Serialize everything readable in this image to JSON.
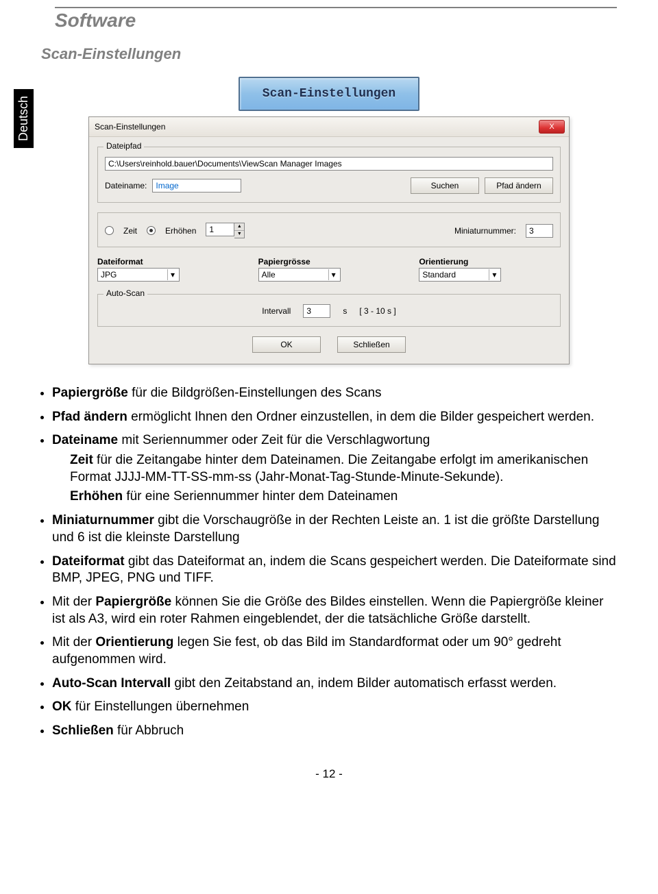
{
  "header": {
    "title": "Software",
    "subtitle": "Scan-Einstellungen"
  },
  "lang_tab": "Deutsch",
  "toolbar_button": {
    "label": "Scan-Einstellungen"
  },
  "dialog": {
    "title": "Scan-Einstellungen",
    "close_x": "X",
    "path_group": {
      "legend": "Dateipfad",
      "path_value": "C:\\Users\\reinhold.bauer\\Documents\\ViewScan Manager Images",
      "filename_label": "Dateiname:",
      "filename_value": "Image",
      "search_btn": "Suchen",
      "change_path_btn": "Pfad ändern"
    },
    "naming_group": {
      "radio_time": "Zeit",
      "radio_increment": "Erhöhen",
      "increment_value": "1",
      "thumb_label": "Miniaturnummer:",
      "thumb_value": "3"
    },
    "format_row": {
      "format_label": "Dateiformat",
      "format_value": "JPG",
      "paper_label": "Papiergrösse",
      "paper_value": "Alle",
      "orient_label": "Orientierung",
      "orient_value": "Standard"
    },
    "autoscan_group": {
      "legend": "Auto-Scan",
      "interval_label": "Intervall",
      "interval_value": "3",
      "unit": "s",
      "range_hint": "[ 3 - 10 s ]"
    },
    "buttons": {
      "ok": "OK",
      "close": "Schließen"
    }
  },
  "bullets": {
    "b1_bold": "Papiergröße",
    "b1_rest": " für die Bildgrößen-Einstellungen des Scans",
    "b2_bold": "Pfad ändern",
    "b2_rest": " ermöglicht Ihnen den Ordner einzustellen, in dem die Bilder gespeichert werden.",
    "b3_bold": "Dateiname",
    "b3_rest": " mit Seriennummer oder Zeit für die Verschlagwortung",
    "b3_sub1_bold": "Zeit",
    "b3_sub1_rest": " für die Zeitangabe hinter dem Dateinamen. Die Zeitangabe erfolgt im amerikanischen Format JJJJ-MM-TT-SS-mm-ss (Jahr-Monat-Tag-Stunde-Minute-Sekunde).",
    "b3_sub2_bold": "Erhöhen",
    "b3_sub2_rest": " für eine Seriennummer hinter dem Dateinamen",
    "b4_bold": "Miniaturnummer",
    "b4_rest": " gibt die Vorschaugröße in der Rechten Leiste an. 1 ist die größte Darstellung und 6 ist die kleinste Darstellung",
    "b5_bold": "Dateiformat",
    "b5_rest": " gibt das Dateiformat an, indem die Scans gespeichert werden. Die Dateiformate sind BMP, JPEG, PNG und TIFF.",
    "b6_pre": "Mit der ",
    "b6_bold": "Papiergröße",
    "b6_rest": " können Sie die Größe des Bildes einstellen. Wenn die Papiergröße kleiner ist als A3, wird ein roter Rahmen eingeblendet, der die tatsächliche Größe darstellt.",
    "b7_pre": "Mit der ",
    "b7_bold": "Orientierung",
    "b7_rest": " legen Sie fest, ob das Bild im Standardformat oder um 90° gedreht aufgenommen wird.",
    "b8_bold": "Auto-Scan Intervall",
    "b8_rest": " gibt den Zeitabstand an, indem Bilder automatisch erfasst werden.",
    "b9_bold": "OK",
    "b9_rest": " für Einstellungen übernehmen",
    "b10_bold": "Schließen",
    "b10_rest": " für Abbruch"
  },
  "page_number": "- 12 -"
}
